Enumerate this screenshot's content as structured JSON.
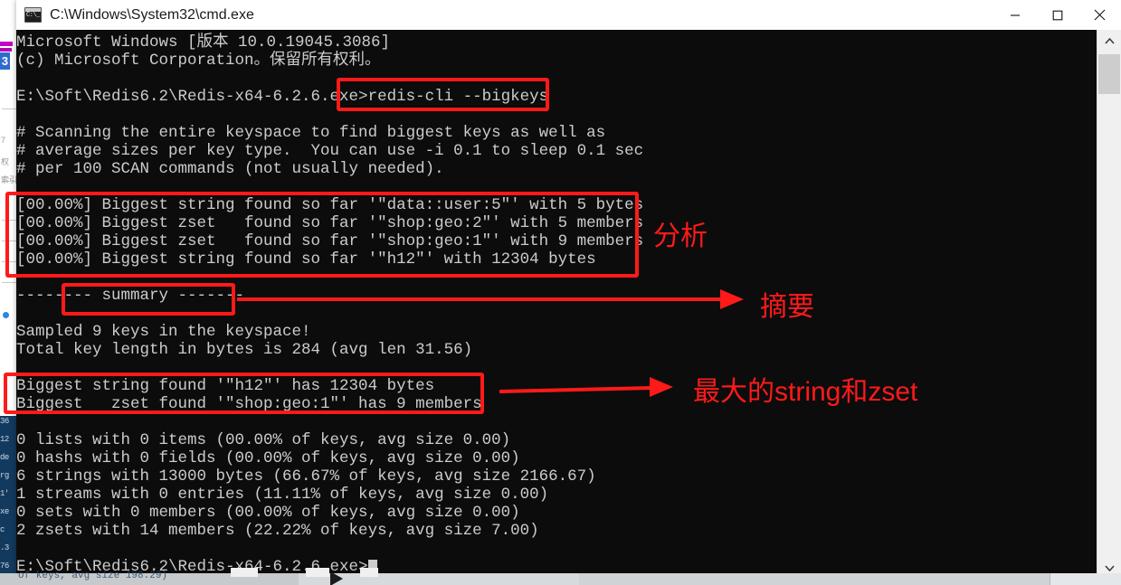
{
  "window": {
    "title": "C:\\Windows\\System32\\cmd.exe",
    "icon": "cmd-console-icon",
    "icon_glyph": "C:\\_",
    "controls": {
      "minimize_label": "Minimize",
      "maximize_label": "Maximize",
      "close_label": "Close"
    }
  },
  "terminal": {
    "lines": [
      "Microsoft Windows [版本 10.0.19045.3086]",
      "(c) Microsoft Corporation。保留所有权利。",
      "",
      "E:\\Soft\\Redis6.2\\Redis-x64-6.2.6.exe>redis-cli --bigkeys",
      "",
      "# Scanning the entire keyspace to find biggest keys as well as",
      "# average sizes per key type.  You can use -i 0.1 to sleep 0.1 sec",
      "# per 100 SCAN commands (not usually needed).",
      "",
      "[00.00%] Biggest string found so far '\"data::user:5\"' with 5 bytes",
      "[00.00%] Biggest zset   found so far '\"shop:geo:2\"' with 5 members",
      "[00.00%] Biggest zset   found so far '\"shop:geo:1\"' with 9 members",
      "[00.00%] Biggest string found so far '\"h12\"' with 12304 bytes",
      "",
      "-------- summary -------",
      "",
      "Sampled 9 keys in the keyspace!",
      "Total key length in bytes is 284 (avg len 31.56)",
      "",
      "Biggest string found '\"h12\"' has 12304 bytes",
      "Biggest   zset found '\"shop:geo:1\"' has 9 members",
      "",
      "0 lists with 0 items (00.00% of keys, avg size 0.00)",
      "0 hashs with 0 fields (00.00% of keys, avg size 0.00)",
      "6 strings with 13000 bytes (66.67% of keys, avg size 2166.67)",
      "1 streams with 0 entries (11.11% of keys, avg size 0.00)",
      "0 sets with 0 members (00.00% of keys, avg size 0.00)",
      "2 zsets with 14 members (22.22% of keys, avg size 7.00)",
      "",
      "E:\\Soft\\Redis6.2\\Redis-x64-6.2.6.exe>"
    ],
    "prompt": "E:\\Soft\\Redis6.2\\Redis-x64-6.2.6.exe>",
    "command": "redis-cli --bigkeys",
    "colors": {
      "background": "#0c0c0c",
      "foreground": "#cccccc"
    }
  },
  "scrollbar": {
    "up_arrow": "˄",
    "down_arrow": "˅"
  },
  "annotations": {
    "accent_color": "#ff1a1a",
    "boxes": [
      {
        "name": "command-highlight-box"
      },
      {
        "name": "analysis-highlight-box"
      },
      {
        "name": "summary-highlight-box"
      },
      {
        "name": "biggest-keys-highlight-box"
      }
    ],
    "labels": [
      {
        "name": "analysis-label",
        "text": "分析"
      },
      {
        "name": "summary-label",
        "text": "摘要"
      },
      {
        "name": "biggest-label",
        "text": "最大的string和zset"
      }
    ]
  },
  "background_windows": {
    "left_badge": "3",
    "bottom_text": "of keys, avg size 198.29)",
    "faint_labels": [
      "7",
      "权",
      "索引"
    ],
    "navy_fragments": [
      "36",
      "12",
      "de",
      "rg",
      "1'",
      "xe",
      "c",
      ".3",
      "76",
      "or"
    ]
  }
}
